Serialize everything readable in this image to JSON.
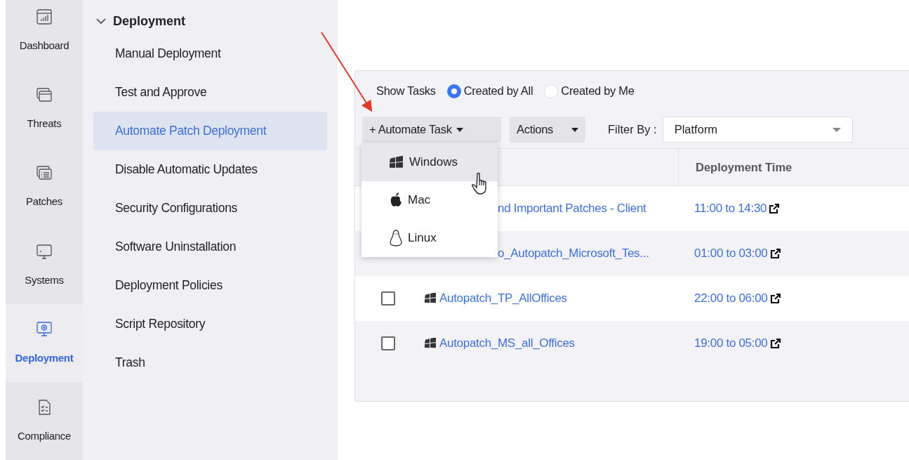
{
  "rail": [
    {
      "label": "Dashboard",
      "kind": "dashboard",
      "selected": false
    },
    {
      "label": "Threats",
      "kind": "threats",
      "selected": false
    },
    {
      "label": "Patches",
      "kind": "patches",
      "selected": false
    },
    {
      "label": "Systems",
      "kind": "systems",
      "selected": false
    },
    {
      "label": "Deployment",
      "kind": "deployment",
      "selected": true
    },
    {
      "label": "Compliance",
      "kind": "compliance",
      "selected": false
    }
  ],
  "submenu": {
    "title": "Deployment",
    "expanded": true,
    "items": [
      {
        "label": "Manual Deployment",
        "selected": false
      },
      {
        "label": "Test and Approve",
        "selected": false
      },
      {
        "label": "Automate Patch Deployment",
        "selected": true
      },
      {
        "label": "Disable Automatic Updates",
        "selected": false
      },
      {
        "label": "Security Configurations",
        "selected": false
      },
      {
        "label": "Software Uninstallation",
        "selected": false
      },
      {
        "label": "Deployment Policies",
        "selected": false
      },
      {
        "label": "Script Repository",
        "selected": false
      },
      {
        "label": "Trash",
        "selected": false
      }
    ]
  },
  "show_tasks": {
    "label": "Show Tasks",
    "options": [
      {
        "label": "Created by All",
        "selected": true
      },
      {
        "label": "Created by Me",
        "selected": false
      }
    ]
  },
  "toolbar": {
    "automate_button": {
      "icon": "+",
      "label": "Automate Task"
    },
    "actions_button": "Actions",
    "filter_label": "Filter By :",
    "filter_select": "Platform"
  },
  "dropdown": [
    {
      "label": "Windows",
      "kind": "windows",
      "selected": true
    },
    {
      "label": "Mac",
      "kind": "mac",
      "selected": false
    },
    {
      "label": "Linux",
      "kind": "linux",
      "selected": false
    }
  ],
  "table": {
    "columns": [
      {
        "label": "Deployment Time"
      }
    ],
    "rows": [
      {
        "kind": "covered",
        "name": "nd Important Patches - Client",
        "time": "11:00 to 14:30"
      },
      {
        "kind": "covered",
        "name": "o_Autopatch_Microsoft_Tes...",
        "time": "01:00 to 03:00"
      },
      {
        "kind": "full",
        "checked": false,
        "name": "Autopatch_TP_AllOffices",
        "time": "22:00 to 06:00"
      },
      {
        "kind": "full",
        "checked": false,
        "name": "Autopatch_MS_all_Offices",
        "time": "19:00 to 05:00"
      }
    ]
  }
}
